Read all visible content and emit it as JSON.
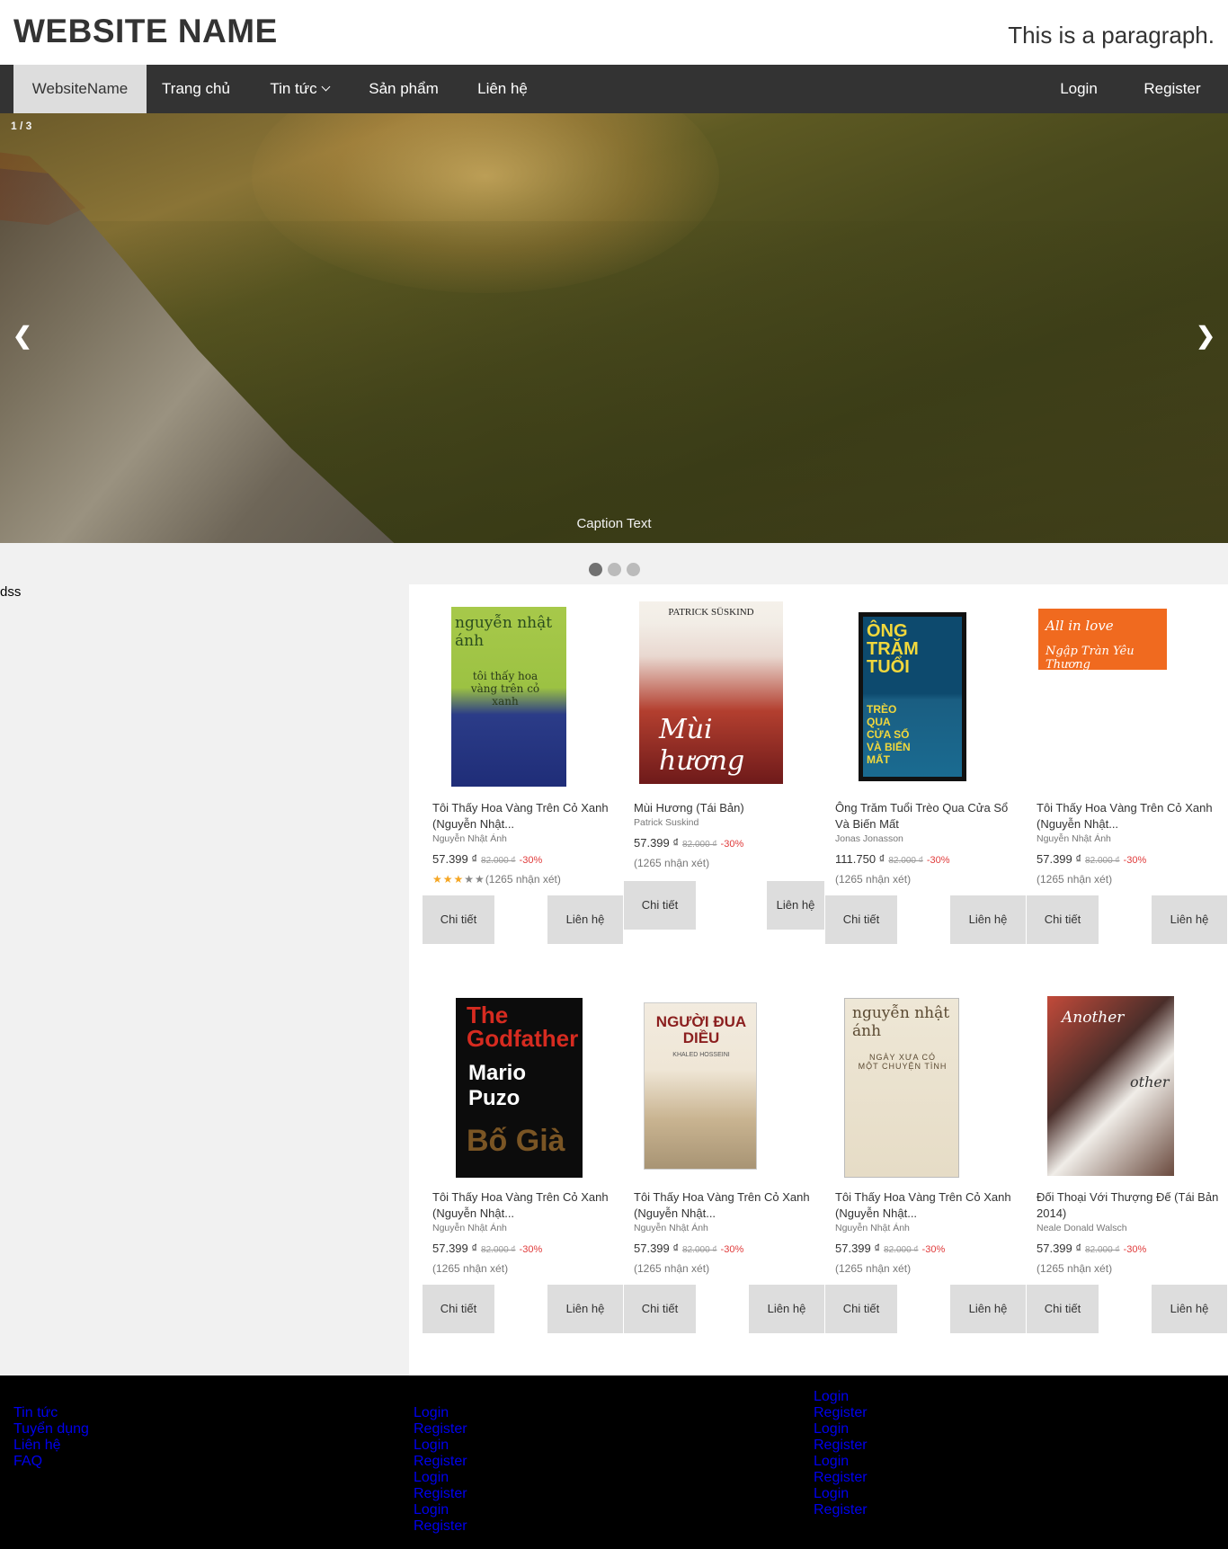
{
  "header": {
    "site_name": "WEBSITE NAME",
    "paragraph": "This is a paragraph."
  },
  "nav": {
    "brand": "WebsiteName",
    "items": [
      "Trang chủ",
      "Tin tức",
      "Sản phẩm",
      "Liên hệ"
    ],
    "right": [
      "Login",
      "Register"
    ]
  },
  "slideshow": {
    "number_text": "1 / 3",
    "caption": "Caption Text",
    "prev": "❮",
    "next": "❯",
    "active_dot": 1,
    "dot_count": 3
  },
  "sidebar": {
    "text": "dss"
  },
  "products": [
    {
      "title": "Tôi Thấy Hoa Vàng Trên Cỏ Xanh (Nguyễn Nhật...",
      "author": "Nguyễn Nhật Ánh",
      "price": "57.399 ₫",
      "old_price": "82.000 ₫",
      "discount": "-30%",
      "reviews": "(1265 nhận xét)",
      "rating": 3,
      "detail": "Chi tiết",
      "contact": "Liên hệ",
      "cover_text": [
        "nguyễn nhật ánh",
        "tôi thấy hoa vàng trên cỏ xanh"
      ]
    },
    {
      "title": "Mùi Hương (Tái Bản)",
      "author": "Patrick Suskind",
      "price": "57.399 ₫",
      "old_price": "82.000 ₫",
      "discount": "-30%",
      "reviews": "(1265 nhận xét)",
      "detail": "Chi tiết",
      "contact": "Liên hệ",
      "cover_text": [
        "PATRICK SÜSKIND",
        "Mùi hương"
      ]
    },
    {
      "title": "Ông Trăm Tuổi Trèo Qua Cửa Sổ Và Biến Mất",
      "author": "Jonas Jonasson",
      "price": "111.750 ₫",
      "old_price": "82.000 ₫",
      "discount": "-30%",
      "reviews": "(1265 nhận xét)",
      "detail": "Chi tiết",
      "contact": "Liên hệ",
      "cover_text": [
        "ÔNG TRĂM TUỔI",
        "TRÈO QUA CỬA SỔ VÀ BIẾN MẤT"
      ]
    },
    {
      "title": "Tôi Thấy Hoa Vàng Trên Cỏ Xanh (Nguyễn Nhật...",
      "author": "Nguyễn Nhật Ánh",
      "price": "57.399 ₫",
      "old_price": "82.000 ₫",
      "discount": "-30%",
      "reviews": "(1265 nhận xét)",
      "detail": "Chi tiết",
      "contact": "Liên hệ",
      "cover_text": [
        "All in love",
        "Ngập Tràn Yêu Thương"
      ]
    },
    {
      "title": "Tôi Thấy Hoa Vàng Trên Cỏ Xanh (Nguyễn Nhật...",
      "author": "Nguyễn Nhật Ánh",
      "price": "57.399 ₫",
      "old_price": "82.000 ₫",
      "discount": "-30%",
      "reviews": "(1265 nhận xét)",
      "detail": "Chi tiết",
      "contact": "Liên hệ",
      "cover_text": [
        "The Godfather",
        "Mario Puzo",
        "Bố Già"
      ]
    },
    {
      "title": "Tôi Thấy Hoa Vàng Trên Cỏ Xanh (Nguyễn Nhật...",
      "author": "Nguyễn Nhật Ánh",
      "price": "57.399 ₫",
      "old_price": "82.000 ₫",
      "discount": "-30%",
      "reviews": "(1265 nhận xét)",
      "detail": "Chi tiết",
      "contact": "Liên hệ",
      "cover_text": [
        "NGƯỜI ĐUA DIỀU",
        "KHALED HOSSEINI"
      ]
    },
    {
      "title": "Tôi Thấy Hoa Vàng Trên Cỏ Xanh (Nguyễn Nhật...",
      "author": "Nguyễn Nhật Ánh",
      "price": "57.399 ₫",
      "old_price": "82.000 ₫",
      "discount": "-30%",
      "reviews": "(1265 nhận xét)",
      "detail": "Chi tiết",
      "contact": "Liên hệ",
      "cover_text": [
        "nguyễn nhật ánh",
        "NGÀY XƯA CÓ MỘT CHUYỆN TÌNH"
      ]
    },
    {
      "title": "Đối Thoại Với Thượng Đế (Tái Bản 2014)",
      "author": "Neale Donald Walsch",
      "price": "57.399 ₫",
      "old_price": "82.000 ₫",
      "discount": "-30%",
      "reviews": "(1265 nhận xét)",
      "detail": "Chi tiết",
      "contact": "Liên hệ",
      "cover_text": [
        "Another",
        "other"
      ]
    }
  ],
  "footer": {
    "col1": [
      "Tin tức",
      "Tuyển dụng",
      "Liên hệ",
      "FAQ"
    ],
    "col2": [
      "Login",
      "Register",
      "Login",
      "Register",
      "Login",
      "Register",
      "Login",
      "Register"
    ],
    "col3": [
      "Login",
      "Register",
      "Login",
      "Register",
      "Login",
      "Register",
      "Login",
      "Register"
    ]
  },
  "colors": {
    "navbar": "#333333",
    "nav_active": "#dddddd",
    "button": "#dddddd",
    "discount": "#e03b3b",
    "star": "#f5a623",
    "footer": "#000000",
    "footer_link": "#0000ee"
  }
}
